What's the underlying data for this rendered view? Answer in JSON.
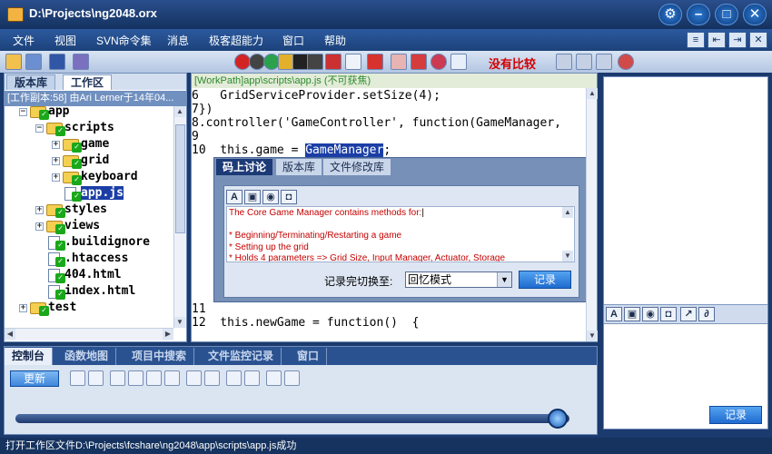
{
  "window": {
    "title": "D:\\Projects\\ng2048.orx"
  },
  "menu": {
    "items": [
      "文件",
      "视图",
      "SVN命令集",
      "消息",
      "极客超能力",
      "窗口",
      "帮助"
    ]
  },
  "toolbar": {
    "no_compare": "没有比较"
  },
  "left_panel": {
    "tabs": [
      "版本库",
      "工作区"
    ],
    "active_tab": "工作区",
    "working_copy_info": "[工作副本:58] 由Ari Lerner于14年04...",
    "tree": [
      {
        "label": "app",
        "depth": 0,
        "type": "folder",
        "expanded": true
      },
      {
        "label": "scripts",
        "depth": 1,
        "type": "folder",
        "expanded": true
      },
      {
        "label": "game",
        "depth": 2,
        "type": "folder",
        "expanded": false
      },
      {
        "label": "grid",
        "depth": 2,
        "type": "folder",
        "expanded": false
      },
      {
        "label": "keyboard",
        "depth": 2,
        "type": "folder",
        "expanded": false
      },
      {
        "label": "app.js",
        "depth": 2,
        "type": "file",
        "selected": true
      },
      {
        "label": "styles",
        "depth": 1,
        "type": "folder",
        "expanded": false
      },
      {
        "label": "views",
        "depth": 1,
        "type": "folder",
        "expanded": false
      },
      {
        "label": ".buildignore",
        "depth": 1,
        "type": "file"
      },
      {
        "label": ".htaccess",
        "depth": 1,
        "type": "file"
      },
      {
        "label": "404.html",
        "depth": 1,
        "type": "file"
      },
      {
        "label": "index.html",
        "depth": 1,
        "type": "file"
      },
      {
        "label": "test",
        "depth": 0,
        "type": "folder",
        "expanded": false
      }
    ]
  },
  "editor": {
    "path": "[WorkPath]app\\scripts\\app.js (不可获焦)",
    "lines_top": [
      {
        "num": "6",
        "text": "  GridServiceProvider.setSize(4);"
      },
      {
        "num": "7",
        "text": "})"
      },
      {
        "num": "8",
        "text": ".controller('GameController', function(GameManager,"
      },
      {
        "num": "9",
        "text": ""
      },
      {
        "num": "10",
        "pre": "  this.game = ",
        "highlight": "GameManager",
        "post": ";"
      }
    ],
    "lines_bottom": [
      {
        "num": "11",
        "text": ""
      },
      {
        "num": "12",
        "text": "  this.newGame = function()  {"
      }
    ]
  },
  "popup": {
    "tabs": [
      "码上讨论",
      "版本库",
      "文件修改库"
    ],
    "active_tab": "码上讨论",
    "note_lines": [
      "The Core Game Manager contains methods for:",
      "",
      "* Beginning/Terminating/Restarting a game",
      "* Setting up the grid",
      "* Holds 4 parameters => Grid Size, Input Manager, Actuator, Storage"
    ],
    "switch_label": "记录完切换至:",
    "switch_value": "回忆模式",
    "record_button": "记录"
  },
  "right_panel": {
    "record_button": "记录"
  },
  "bottom_panel": {
    "tabs": [
      "控制台",
      "函数地图",
      "项目中搜索",
      "文件监控记录",
      "窗口"
    ],
    "active_tab": "控制台",
    "update_button": "更新",
    "progress": 0.98
  },
  "status": {
    "text": "打开工作区文件D:\\Projects\\fcshare\\ng2048\\app\\scripts\\app.js成功"
  }
}
